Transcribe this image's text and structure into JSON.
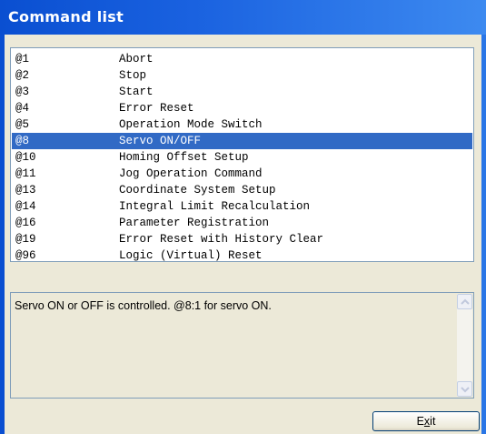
{
  "window": {
    "title": "Command list"
  },
  "commands": [
    {
      "code": "@1",
      "name": "Abort"
    },
    {
      "code": "@2",
      "name": "Stop"
    },
    {
      "code": "@3",
      "name": "Start"
    },
    {
      "code": "@4",
      "name": "Error Reset"
    },
    {
      "code": "@5",
      "name": "Operation Mode Switch"
    },
    {
      "code": "@8",
      "name": "Servo ON/OFF"
    },
    {
      "code": "@10",
      "name": "Homing Offset Setup"
    },
    {
      "code": "@11",
      "name": "Jog Operation Command"
    },
    {
      "code": "@13",
      "name": "Coordinate System Setup"
    },
    {
      "code": "@14",
      "name": "Integral Limit Recalculation"
    },
    {
      "code": "@16",
      "name": "Parameter Registration"
    },
    {
      "code": "@19",
      "name": "Error Reset with History Clear"
    },
    {
      "code": "@96",
      "name": "Logic (Virtual) Reset"
    }
  ],
  "selected_code": "@8",
  "description": {
    "text": "Servo ON or OFF is controlled.  @8:1 for servo ON."
  },
  "exit_button": {
    "label_pre": "E",
    "label_underlined": "x",
    "label_post": "it"
  },
  "colors": {
    "title_bar": "#0a4fd1",
    "selection": "#316ac5",
    "dialog_bg": "#ece9d8"
  },
  "icons": {
    "scroll_up": "chevron-up-icon",
    "scroll_down": "chevron-down-icon"
  }
}
